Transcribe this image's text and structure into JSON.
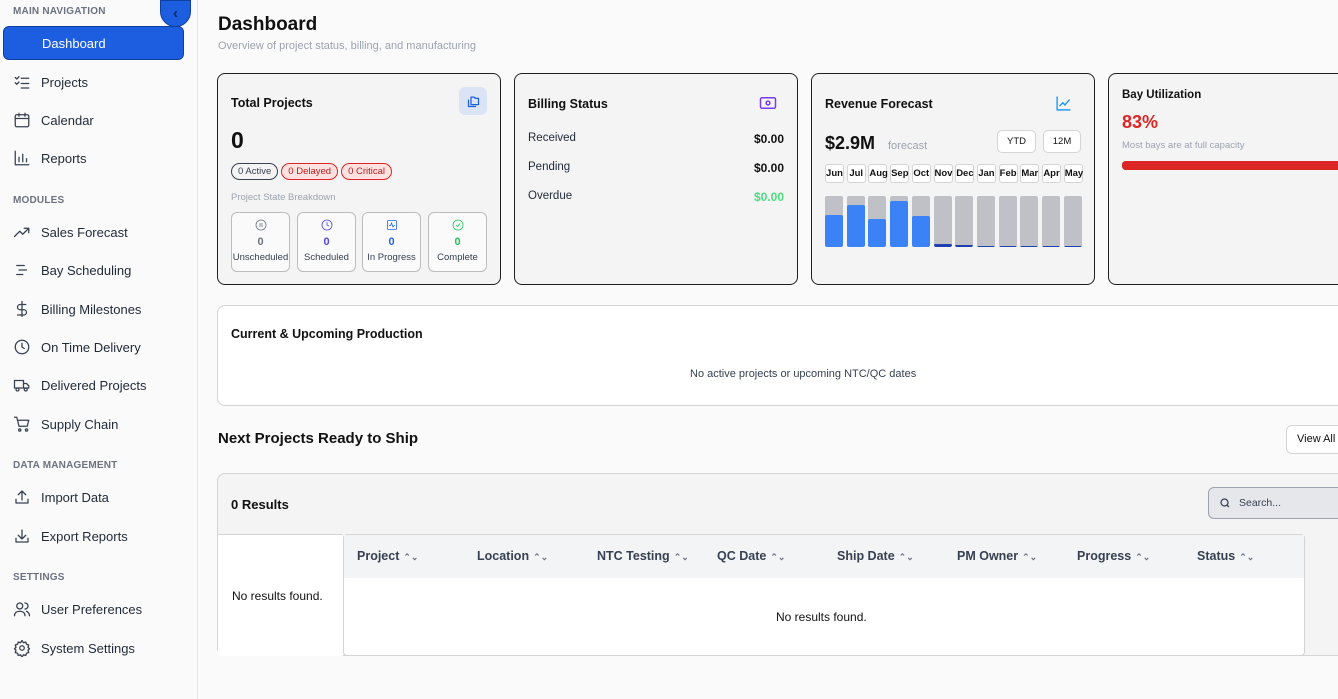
{
  "sidebar": {
    "sections": {
      "main_nav": "MAIN NAVIGATION",
      "modules": "MODULES",
      "data_management": "DATA MANAGEMENT",
      "settings": "SETTINGS"
    },
    "items": {
      "dashboard": "Dashboard",
      "projects": "Projects",
      "calendar": "Calendar",
      "reports": "Reports",
      "sales_forecast": "Sales Forecast",
      "bay_scheduling": "Bay Scheduling",
      "billing_milestones": "Billing Milestones",
      "on_time_delivery": "On Time Delivery",
      "delivered_projects": "Delivered Projects",
      "supply_chain": "Supply Chain",
      "import_data": "Import Data",
      "export_reports": "Export Reports",
      "user_preferences": "User Preferences",
      "system_settings": "System Settings"
    }
  },
  "header": {
    "title": "Dashboard",
    "subtitle": "Overview of project status, billing, and manufacturing"
  },
  "total_projects": {
    "title": "Total Projects",
    "count": "0",
    "chips": {
      "active": "0 Active",
      "delayed": "0 Delayed",
      "critical": "0 Critical"
    },
    "breakdown_label": "Project State Breakdown",
    "states": {
      "unscheduled": {
        "value": "0",
        "label": "Unscheduled"
      },
      "scheduled": {
        "value": "0",
        "label": "Scheduled"
      },
      "in_progress": {
        "value": "0",
        "label": "In Progress"
      },
      "complete": {
        "value": "0",
        "label": "Complete"
      }
    }
  },
  "billing": {
    "title": "Billing Status",
    "received_label": "Received",
    "received_value": "$0.00",
    "pending_label": "Pending",
    "pending_value": "$0.00",
    "overdue_label": "Overdue",
    "overdue_value": "$0.00"
  },
  "revenue": {
    "title": "Revenue Forecast",
    "amount": "$2.9M",
    "amount_suffix": "forecast",
    "ytd_label": "YTD",
    "twelve_label": "12M",
    "months": [
      {
        "label": "Jun",
        "level": 0.62
      },
      {
        "label": "Jul",
        "level": 0.82
      },
      {
        "label": "Aug",
        "level": 0.55
      },
      {
        "label": "Sep",
        "level": 0.9
      },
      {
        "label": "Oct",
        "level": 0.6
      },
      {
        "label": "Nov",
        "level": 0.06
      },
      {
        "label": "Dec",
        "level": 0.03
      },
      {
        "label": "Jan",
        "level": 0.02
      },
      {
        "label": "Feb",
        "level": 0.02
      },
      {
        "label": "Mar",
        "level": 0.02
      },
      {
        "label": "Apr",
        "level": 0.02
      },
      {
        "label": "May",
        "level": 0.02
      }
    ]
  },
  "bay": {
    "title": "Bay Utilization",
    "percent": "83%",
    "note": "Most bays are at full capacity",
    "level": 0.83
  },
  "production": {
    "title": "Current & Upcoming Production",
    "empty": "No active projects or upcoming NTC/QC dates"
  },
  "ready_to_ship": {
    "title": "Next Projects Ready to Ship",
    "view_all": "View All",
    "results": "0 Results",
    "search_placeholder": "Search...",
    "left_empty": "No results found.",
    "columns": [
      "Project",
      "Location",
      "NTC Testing",
      "QC Date",
      "Ship Date",
      "PM Owner",
      "Progress",
      "Status"
    ],
    "empty": "No results found."
  },
  "colors": {
    "accent": "#1d5ee0",
    "danger": "#dc2626",
    "success": "#22c55e",
    "bar": "#3b82f6"
  }
}
